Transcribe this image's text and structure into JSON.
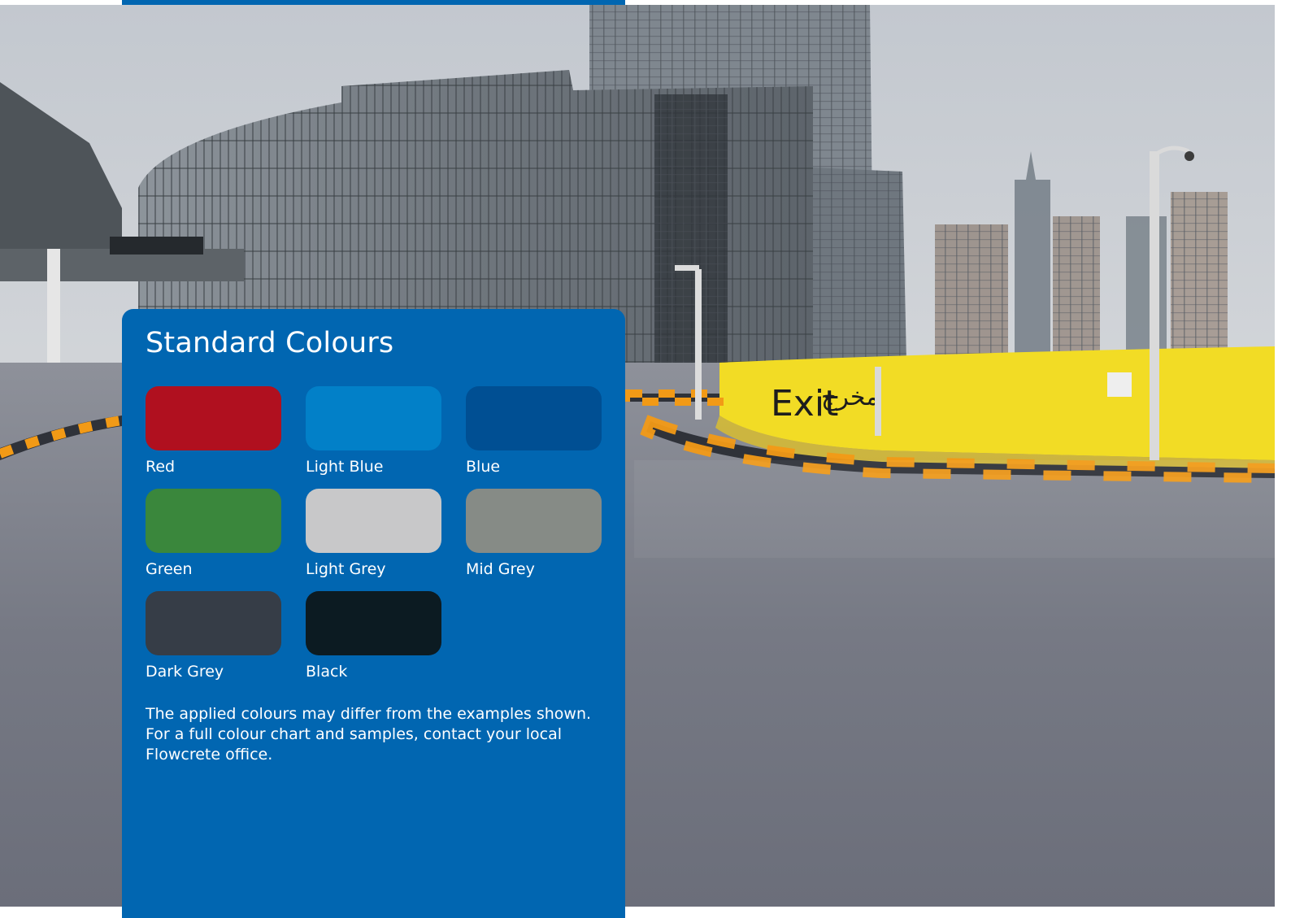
{
  "panel": {
    "title": "Standard Colours",
    "swatches": [
      {
        "label": "Red",
        "color": "#b0101f"
      },
      {
        "label": "Light Blue",
        "color": "#0280c8"
      },
      {
        "label": "Blue",
        "color": "#004f93"
      },
      {
        "label": "Green",
        "color": "#3a873c"
      },
      {
        "label": "Light Grey",
        "color": "#c8c8c9"
      },
      {
        "label": "Mid Grey",
        "color": "#868b86"
      },
      {
        "label": "Dark Grey",
        "color": "#363d47"
      },
      {
        "label": "Black",
        "color": "#0c1b22"
      }
    ],
    "disclaimer_lines": [
      "The applied colours may differ from the examples shown.",
      "For a full colour chart and samples, contact your local",
      "Flowcrete office."
    ]
  },
  "photo": {
    "sign_text": "Exit",
    "sign_text_arabic": "مخرج"
  },
  "colors": {
    "panel_blue": "#0166b1",
    "wall_yellow": "#f2dc25",
    "kerb_orange": "#f29a16"
  }
}
